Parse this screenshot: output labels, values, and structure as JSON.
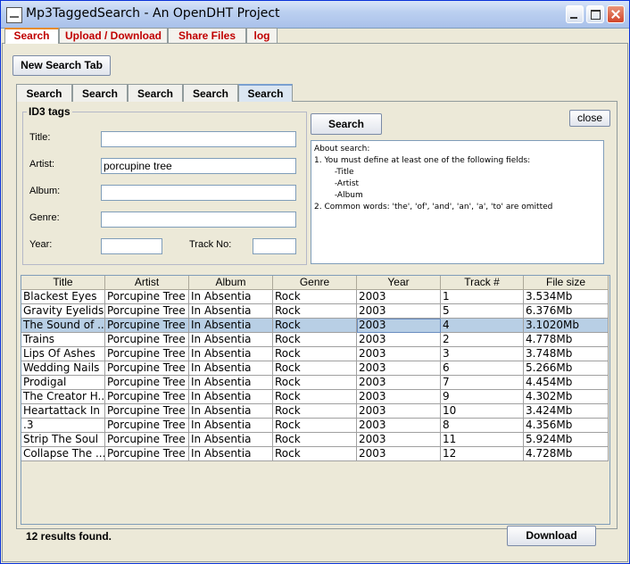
{
  "window": {
    "title": "Mp3TaggedSearch - An OpenDHT Project"
  },
  "main_tabs": [
    {
      "label": "Search",
      "active": true
    },
    {
      "label": "Upload / Download",
      "active": false
    },
    {
      "label": "Share Files",
      "active": false
    },
    {
      "label": "log",
      "active": false
    }
  ],
  "new_search_tab_label": "New Search Tab",
  "search_tabs": [
    {
      "label": "Search",
      "active": false
    },
    {
      "label": "Search",
      "active": false
    },
    {
      "label": "Search",
      "active": false
    },
    {
      "label": "Search",
      "active": false
    },
    {
      "label": "Search",
      "active": true
    }
  ],
  "close_label": "close",
  "id3": {
    "legend": "ID3 tags",
    "title_label": "Title:",
    "title_value": "",
    "artist_label": "Artist:",
    "artist_value": "porcupine tree",
    "album_label": "Album:",
    "album_value": "",
    "genre_label": "Genre:",
    "genre_value": "",
    "year_label": "Year:",
    "year_value": "",
    "track_label": "Track No:",
    "track_value": ""
  },
  "search_button_label": "Search",
  "about_text": "About search:\n1. You must define at least one of the following fields:\n        -Title\n        -Artist\n        -Album\n2. Common words: 'the', 'of', 'and', 'an', 'a', 'to' are omitted",
  "table": {
    "columns": [
      "Title",
      "Artist",
      "Album",
      "Genre",
      "Year",
      "Track #",
      "File size"
    ],
    "selected_row": 2,
    "rows": [
      [
        "Blackest Eyes",
        "Porcupine Tree",
        "In Absentia",
        "Rock",
        "2003",
        "1",
        "3.534Mb"
      ],
      [
        "Gravity Eyelids",
        "Porcupine Tree",
        "In Absentia",
        "Rock",
        "2003",
        "5",
        "6.376Mb"
      ],
      [
        "The Sound of ...",
        "Porcupine Tree",
        "In Absentia",
        "Rock",
        "2003",
        "4",
        "3.1020Mb"
      ],
      [
        "Trains",
        "Porcupine Tree",
        "In Absentia",
        "Rock",
        "2003",
        "2",
        "4.778Mb"
      ],
      [
        "Lips Of Ashes",
        "Porcupine Tree",
        "In Absentia",
        "Rock",
        "2003",
        "3",
        "3.748Mb"
      ],
      [
        "Wedding Nails",
        "Porcupine Tree",
        "In Absentia",
        "Rock",
        "2003",
        "6",
        "5.266Mb"
      ],
      [
        "Prodigal",
        "Porcupine Tree",
        "In Absentia",
        "Rock",
        "2003",
        "7",
        "4.454Mb"
      ],
      [
        "The Creator H...",
        "Porcupine Tree",
        "In Absentia",
        "Rock",
        "2003",
        "9",
        "4.302Mb"
      ],
      [
        "Heartattack In ...",
        "Porcupine Tree",
        "In Absentia",
        "Rock",
        "2003",
        "10",
        "3.424Mb"
      ],
      [
        ".3",
        "Porcupine Tree",
        "In Absentia",
        "Rock",
        "2003",
        "8",
        "4.356Mb"
      ],
      [
        "Strip The Soul",
        "Porcupine Tree",
        "In Absentia",
        "Rock",
        "2003",
        "11",
        "5.924Mb"
      ],
      [
        "Collapse The ...",
        "Porcupine Tree",
        "In Absentia",
        "Rock",
        "2003",
        "12",
        "4.728Mb"
      ]
    ]
  },
  "status_text": "12 results found.",
  "download_label": "Download"
}
